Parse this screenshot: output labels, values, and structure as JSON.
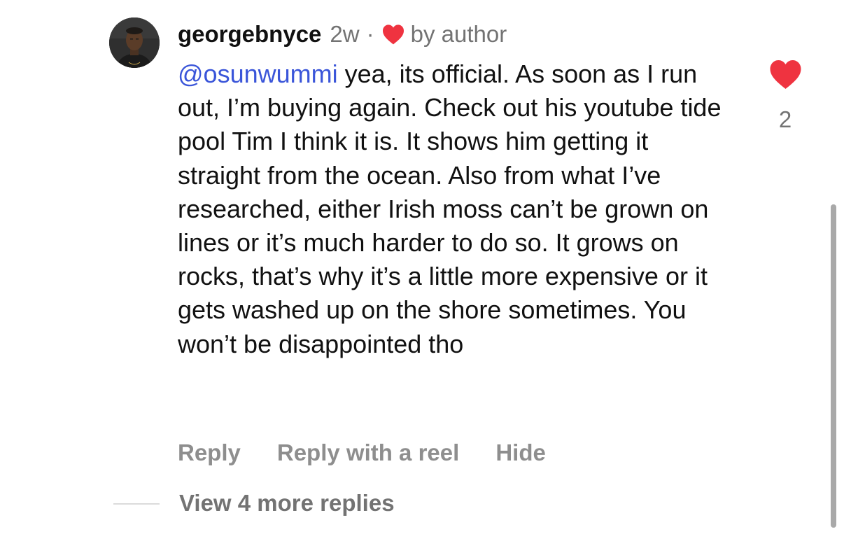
{
  "comment": {
    "username": "georgebnyce",
    "time": "2w",
    "separator": "·",
    "liked_label": "by author",
    "mention": "@osunwummi",
    "text": " yea, its official. As soon as I run out, I’m buying again. Check out his youtube tide pool Tim I think it is. It shows him getting it straight from the ocean. Also from what I’ve researched, either Irish moss can’t be grown on lines or it’s much harder to do so. It grows on rocks, that’s why it’s a little more expensive or it gets washed up on the shore sometimes. You won’t be disappointed tho",
    "like_count": "2",
    "liked": true
  },
  "actions": {
    "reply": "Reply",
    "reply_reel": "Reply with a reel",
    "hide": "Hide"
  },
  "replies": {
    "view_more": "View 4 more replies"
  },
  "icons": {
    "avatar": "avatar",
    "small_heart": "heart-icon",
    "like_heart": "heart-icon"
  },
  "colors": {
    "heart": "#ef3340",
    "mention": "#3a55d9",
    "secondary_text": "#737373",
    "action_text": "#8e8e8e"
  }
}
